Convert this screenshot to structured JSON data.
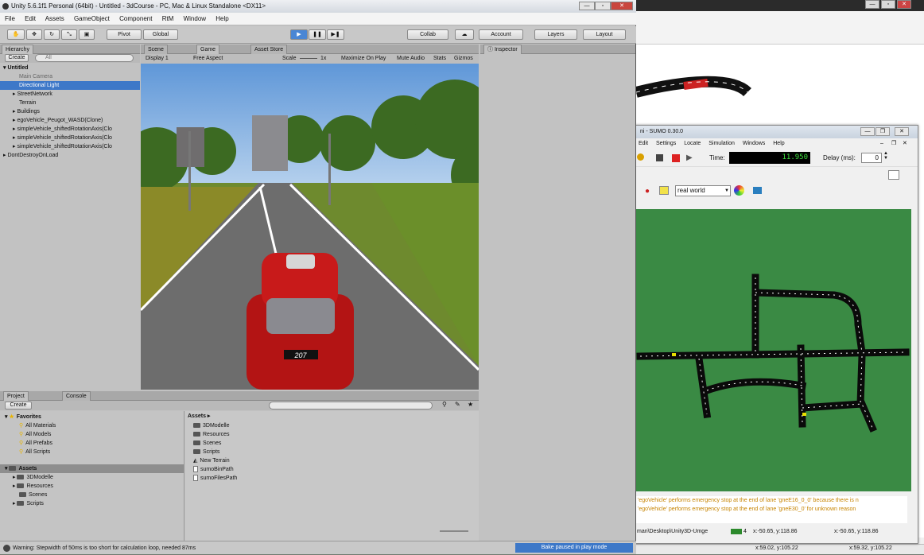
{
  "bg_window": {
    "coords_right": "x:59.32, y:105.22",
    "coords_left": "x:59.02, y:105.22"
  },
  "sumo": {
    "title": "ni - SUMO 0.30.0",
    "menu": [
      "Edit",
      "Settings",
      "Locate",
      "Simulation",
      "Windows",
      "Help"
    ],
    "time_label": "Time:",
    "time_value": "11.950",
    "delay_label": "Delay (ms):",
    "delay_value": "0",
    "scheme": "real world",
    "messages": [
      "'egoVehicle' performs emergency stop at the end of lane 'gneE16_0_0' because there is n",
      "'egoVehicle' performs emergency stop at the end of lane 'gneE30_0' for unknown reason"
    ],
    "status_path": "man\\Desktop\\Unity3D-Umge",
    "status_count": "4",
    "coords_1": "x:-50.65, y:118.86",
    "coords_2": "x:-50.65, y:118.86"
  },
  "unity": {
    "title": "Unity 5.6.1f1 Personal (64bit) - Untitled - 3dCourse - PC, Mac & Linux Standalone <DX11>",
    "menu": [
      "File",
      "Edit",
      "Assets",
      "GameObject",
      "Component",
      "RtM",
      "Window",
      "Help"
    ],
    "toolbar": {
      "pivot": "Pivot",
      "global": "Global",
      "collab": "Collab",
      "account": "Account",
      "layers": "Layers",
      "layout": "Layout"
    },
    "hierarchy": {
      "tab": "Hierarchy",
      "create": "Create",
      "search": "All",
      "scene": "Untitled",
      "items": [
        "Main Camera",
        "Directional Light",
        "StreetNetwork",
        "Terrain",
        "Buildings",
        "egoVehicle_Peugot_WASD(Clone)",
        "simpleVehicle_shiftedRotationAxis(Clo",
        "simpleVehicle_shiftedRotationAxis(Clo",
        "simpleVehicle_shiftedRotationAxis(Clo"
      ],
      "dont_destroy": "DontDestroyOnLoad"
    },
    "tabs": {
      "scene": "Scene",
      "game": "Game",
      "asset_store": "Asset Store",
      "inspector": "Inspector"
    },
    "game_bar": {
      "display": "Display 1",
      "aspect": "Free Aspect",
      "scale_label": "Scale",
      "scale_value": "1x",
      "maximize": "Maximize On Play",
      "mute": "Mute Audio",
      "stats": "Stats",
      "gizmos": "Gizmos"
    },
    "car_plate": "207",
    "project": {
      "tab_project": "Project",
      "tab_console": "Console",
      "create": "Create",
      "favorites": "Favorites",
      "fav_items": [
        "All Materials",
        "All Models",
        "All Prefabs",
        "All Scripts"
      ],
      "assets_root": "Assets",
      "tree_items": [
        "3DModelle",
        "Resources",
        "Scenes",
        "Scripts"
      ],
      "assets_header": "Assets",
      "asset_folders": [
        "3DModelle",
        "Resources",
        "Scenes",
        "Scripts"
      ],
      "asset_terrain": "New Terrain",
      "asset_files": [
        "sumoBinPath",
        "sumoFilesPath"
      ]
    },
    "console_warning": "Warning: Stepwidth of 50ms is too short for calculation loop, needed 87ms",
    "bake_status": "Bake paused in play mode"
  }
}
